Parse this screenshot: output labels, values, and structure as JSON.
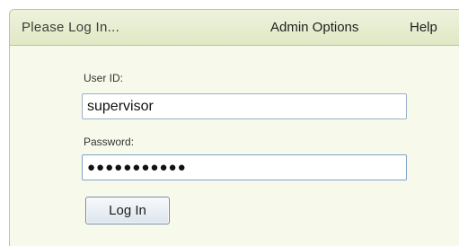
{
  "header": {
    "title": "Please Log In...",
    "admin_options": "Admin Options",
    "help": "Help"
  },
  "form": {
    "userid_label": "User ID:",
    "userid_value": "supervisor",
    "password_label": "Password:",
    "password_value": "●●●●●●●●●●●",
    "login_button": "Log In"
  },
  "colors": {
    "panel_background": "#f7faea",
    "header_background": "#dfe8c4",
    "border": "#b7c98e",
    "field_border": "#9bb0c8"
  }
}
